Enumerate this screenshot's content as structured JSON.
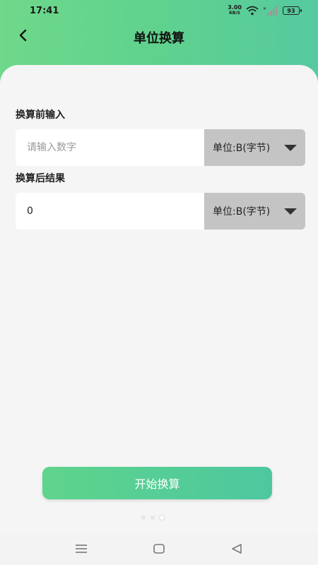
{
  "status": {
    "time": "17:41",
    "net_speed_value": "3.00",
    "net_speed_unit": "KB/S",
    "battery": "93"
  },
  "header": {
    "title": "单位换算",
    "back_icon": "chevron-left-icon"
  },
  "input_section": {
    "label": "换算前输入",
    "placeholder": "请输入数字",
    "value": "",
    "unit_label": "单位:B(字节)"
  },
  "result_section": {
    "label": "换算后结果",
    "value": "0",
    "unit_label": "单位:B(字节)"
  },
  "actions": {
    "start_label": "开始换算"
  },
  "pager": {
    "count": 3,
    "active_index": 2
  },
  "system_nav": {
    "menu_icon": "menu-icon",
    "home_icon": "home-square-icon",
    "back_icon": "back-triangle-icon"
  },
  "colors": {
    "accent_start": "#6fd88a",
    "accent_end": "#4dc79f",
    "unit_bg": "#c4c4c4"
  }
}
